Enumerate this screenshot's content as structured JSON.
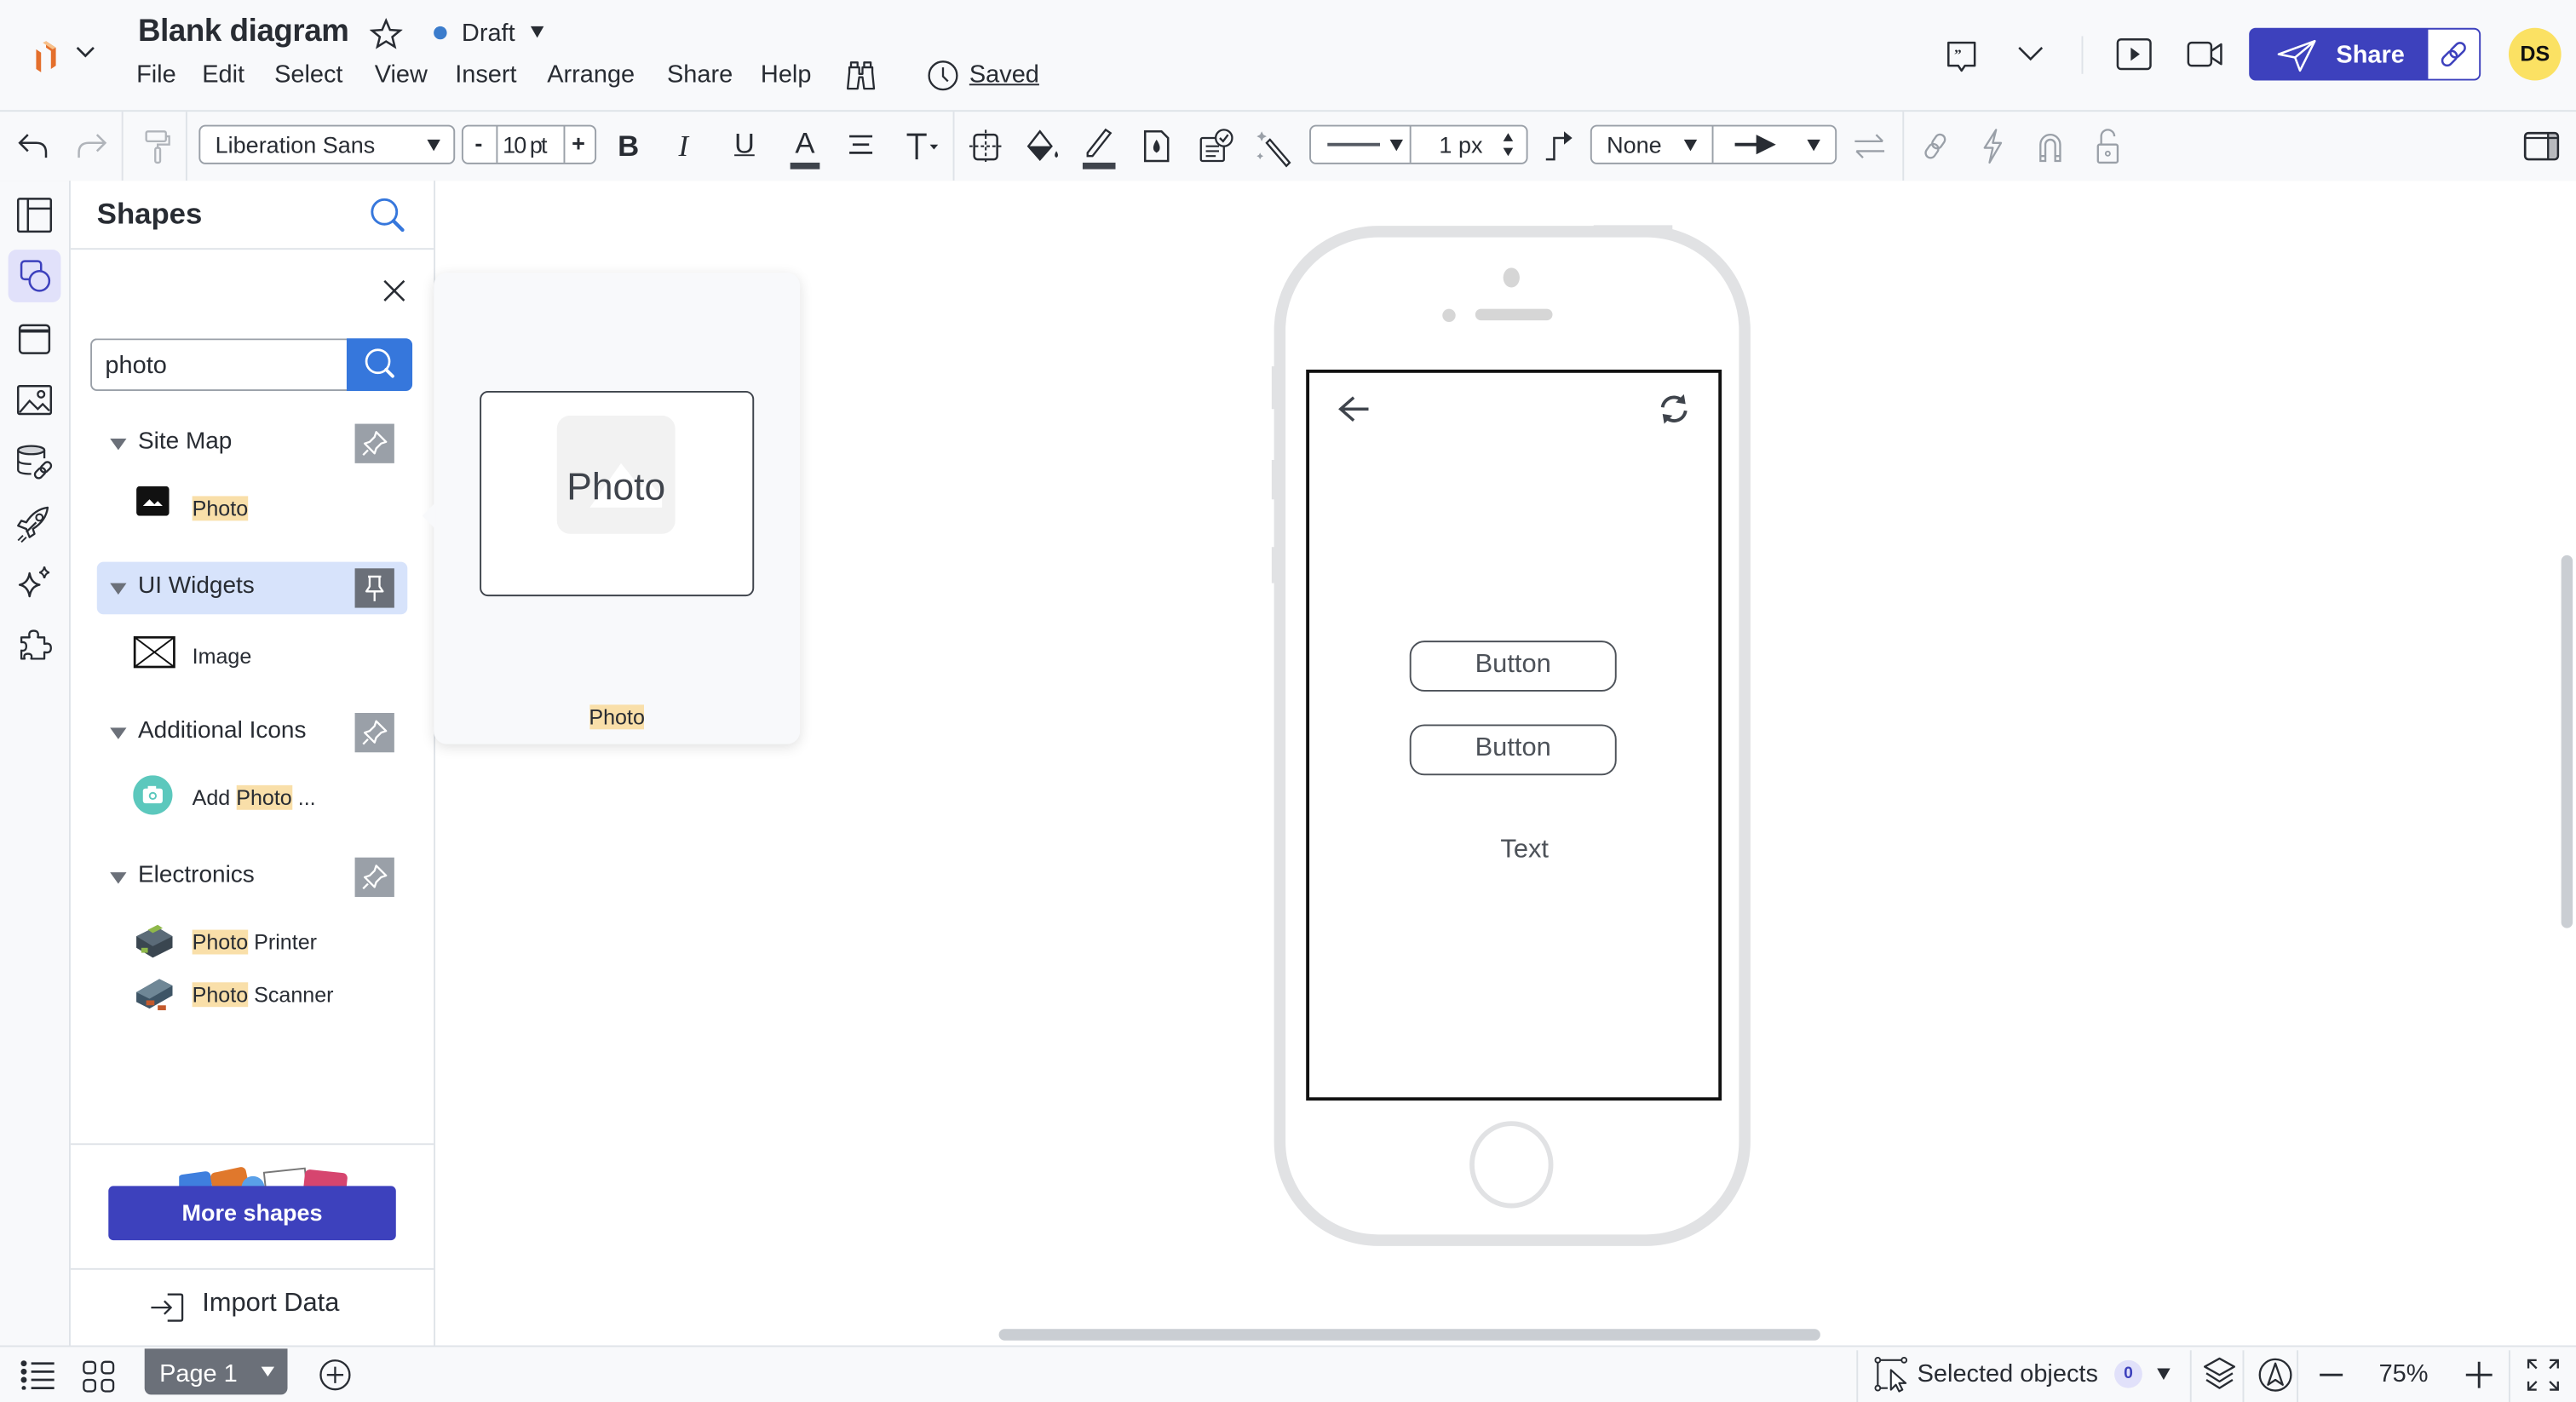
{
  "header": {
    "title": "Blank diagram",
    "status": "Draft",
    "status_color": "#3b7ccc",
    "saved_label": "Saved",
    "menu": [
      "File",
      "Edit",
      "Select",
      "View",
      "Insert",
      "Arrange",
      "Share",
      "Help"
    ],
    "share_label": "Share",
    "avatar_initials": "DS",
    "avatar_color": "#fbe163",
    "brand_color": "#3d41bd"
  },
  "toolbar": {
    "font_family": "Liberation Sans",
    "font_size": "10 pt",
    "font_minus": "-",
    "font_plus": "+",
    "line_width": "1 px",
    "arrow_start": "None"
  },
  "shapes_panel": {
    "title": "Shapes",
    "search_value": "photo",
    "categories": [
      {
        "label": "Site Map",
        "items": [
          {
            "pre": "",
            "hl": "Photo",
            "post": ""
          }
        ]
      },
      {
        "label": "UI Widgets",
        "items": [
          {
            "pre": "Image",
            "hl": "",
            "post": ""
          }
        ]
      },
      {
        "label": "Additional Icons",
        "items": [
          {
            "pre": "Add ",
            "hl": "Photo",
            "post": " ..."
          }
        ]
      },
      {
        "label": "Electronics",
        "items": [
          {
            "pre": "",
            "hl": "Photo",
            "post": " Printer"
          },
          {
            "pre": "",
            "hl": "Photo",
            "post": " Scanner"
          }
        ]
      }
    ],
    "more_shapes_label": "More shapes",
    "import_data_label": "Import Data"
  },
  "preview_popup": {
    "shape_text": "Photo",
    "caption": "Photo"
  },
  "canvas": {
    "phone_buttons": [
      "Button",
      "Button"
    ],
    "phone_text": "Text"
  },
  "statusbar": {
    "page_label": "Page 1",
    "selected_objects_label": "Selected objects",
    "selected_count": "0",
    "zoom": "75%"
  }
}
